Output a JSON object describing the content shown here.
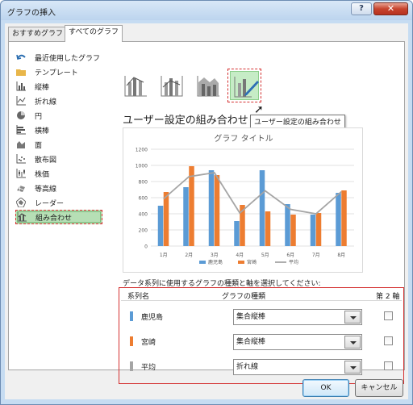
{
  "window": {
    "title": "グラフの挿入",
    "help_label": "?",
    "close_label": "✕"
  },
  "tabs": [
    {
      "label": "おすすめグラフ",
      "active": false
    },
    {
      "label": "すべてのグラフ",
      "active": true
    }
  ],
  "categories": [
    {
      "label": "最近使用したグラフ",
      "icon": "undo-arrow-icon"
    },
    {
      "label": "テンプレート",
      "icon": "folder-icon"
    },
    {
      "label": "縦棒",
      "icon": "column-chart-icon"
    },
    {
      "label": "折れ線",
      "icon": "line-chart-icon"
    },
    {
      "label": "円",
      "icon": "pie-chart-icon"
    },
    {
      "label": "横棒",
      "icon": "bar-chart-icon"
    },
    {
      "label": "面",
      "icon": "area-chart-icon"
    },
    {
      "label": "散布図",
      "icon": "scatter-chart-icon"
    },
    {
      "label": "株価",
      "icon": "stock-chart-icon"
    },
    {
      "label": "等高線",
      "icon": "surface-chart-icon"
    },
    {
      "label": "レーダー",
      "icon": "radar-chart-icon"
    },
    {
      "label": "組み合わせ",
      "icon": "combo-chart-icon",
      "selected": true
    }
  ],
  "subtypes": {
    "section_title": "ユーザー設定の組み合わせ",
    "tooltip": "ユーザー設定の組み合わせ"
  },
  "series_section": {
    "instruction": "データ系列に使用するグラフの種類と軸を選択してください:",
    "col_series": "系列名",
    "col_type": "グラフの種類",
    "col_axis": "第 2 軸",
    "rows": [
      {
        "name": "鹿児島",
        "type": "集合縦棒",
        "color": "#5b9bd5",
        "secondary": false
      },
      {
        "name": "宮崎",
        "type": "集合縦棒",
        "color": "#ed7d31",
        "secondary": false
      },
      {
        "name": "平均",
        "type": "折れ線",
        "color": "#a5a5a5",
        "secondary": false
      }
    ]
  },
  "buttons": {
    "ok": "OK",
    "cancel": "キャンセル"
  },
  "chart_data": {
    "type": "bar",
    "title": "グラフ タイトル",
    "categories": [
      "1月",
      "2月",
      "3月",
      "4月",
      "5月",
      "6月",
      "7月",
      "8月"
    ],
    "ylim": [
      0,
      1200
    ],
    "yticks": [
      0,
      200,
      400,
      600,
      800,
      1000,
      1200
    ],
    "legend": "bottom",
    "series": [
      {
        "name": "鹿児島",
        "kind": "bar",
        "color": "#5b9bd5",
        "values": [
          500,
          730,
          940,
          310,
          940,
          520,
          390,
          660
        ]
      },
      {
        "name": "宮崎",
        "kind": "bar",
        "color": "#ed7d31",
        "values": [
          670,
          990,
          880,
          510,
          430,
          390,
          410,
          690
        ]
      },
      {
        "name": "平均",
        "kind": "line",
        "color": "#a5a5a5",
        "values": [
          585,
          860,
          910,
          410,
          685,
          455,
          400,
          675
        ]
      }
    ]
  }
}
